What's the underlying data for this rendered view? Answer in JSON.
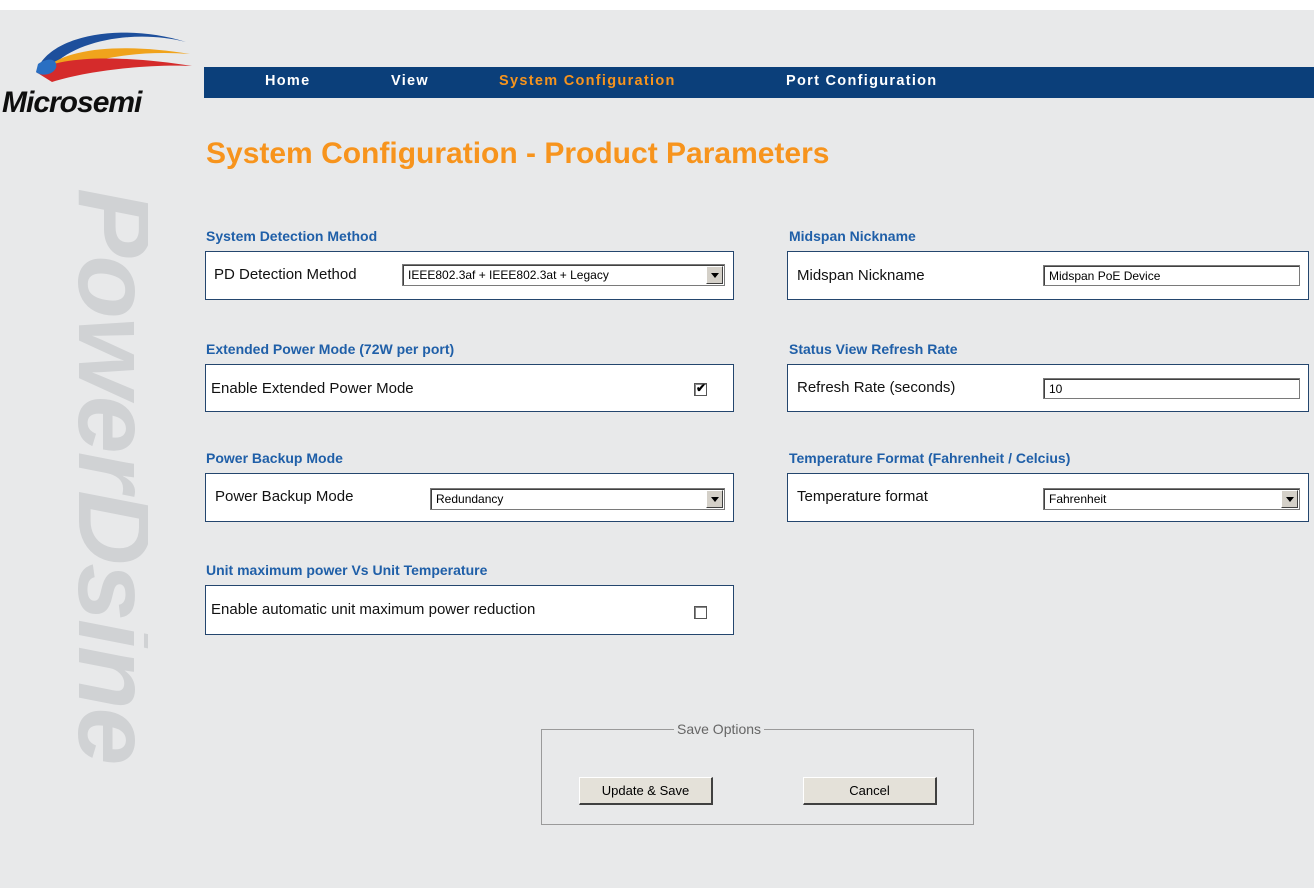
{
  "brand": {
    "logo_text": "Microsemi",
    "watermark_text": "PowerDsine"
  },
  "nav": {
    "items": [
      {
        "label": "Home",
        "active": false
      },
      {
        "label": "View",
        "active": false
      },
      {
        "label": "System Configuration",
        "active": true
      },
      {
        "label": "Port Configuration",
        "active": false
      }
    ]
  },
  "page_title": "System Configuration - Product Parameters",
  "sections": {
    "detection": {
      "title": "System Detection Method",
      "label": "PD Detection Method",
      "value": "IEEE802.3af + IEEE802.3at + Legacy"
    },
    "nickname": {
      "title": "Midspan Nickname",
      "label": "Midspan Nickname",
      "value": "Midspan PoE Device"
    },
    "extended_power": {
      "title": "Extended Power Mode (72W per port)",
      "label": "Enable Extended Power Mode",
      "checked": true
    },
    "refresh": {
      "title": "Status View Refresh Rate",
      "label": "Refresh Rate (seconds)",
      "value": "10"
    },
    "backup": {
      "title": "Power Backup Mode",
      "label": "Power Backup Mode",
      "value": "Redundancy"
    },
    "temperature": {
      "title": "Temperature Format (Fahrenheit / Celcius)",
      "label": "Temperature format",
      "value": "Fahrenheit"
    },
    "max_power": {
      "title": "Unit maximum power Vs Unit Temperature",
      "label": "Enable automatic unit maximum power reduction",
      "checked": false
    }
  },
  "save_options": {
    "legend": "Save Options",
    "update_label": "Update & Save",
    "cancel_label": "Cancel"
  },
  "colors": {
    "nav_bg": "#0b3f7a",
    "accent_orange": "#f7941d",
    "section_blue": "#1f5fa8",
    "page_bg": "#e8e9ea"
  }
}
